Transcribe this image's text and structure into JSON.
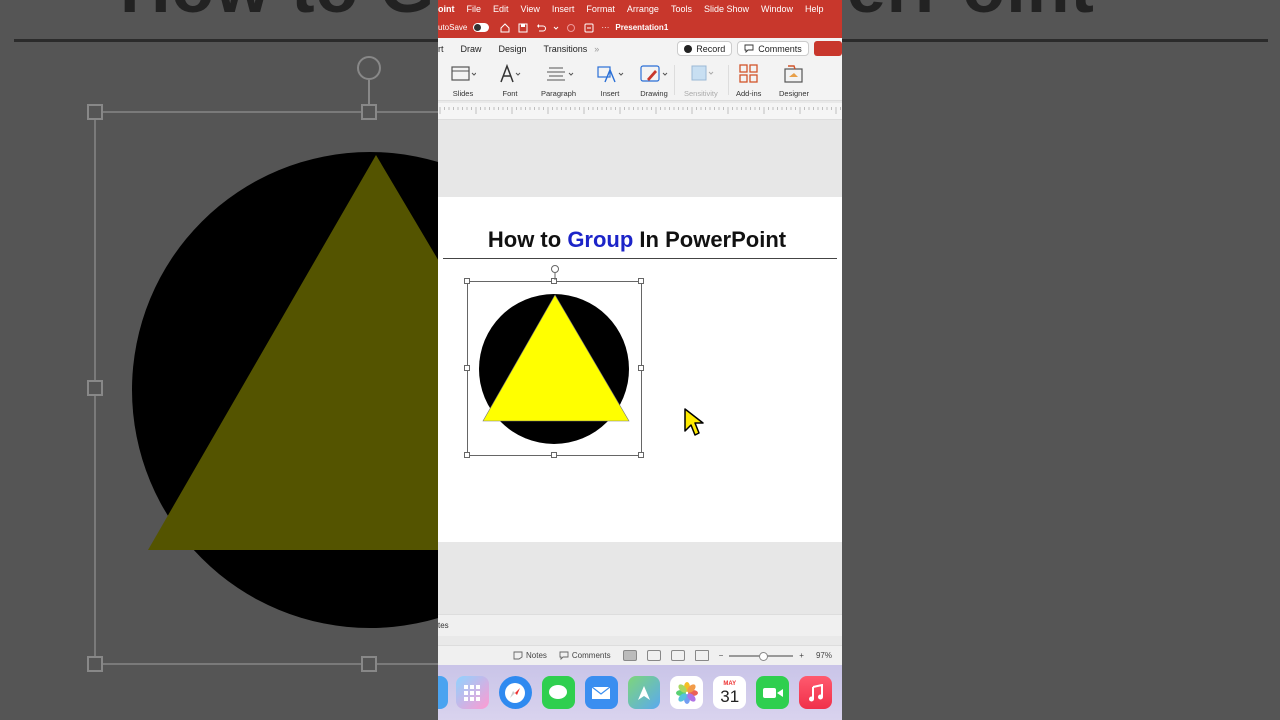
{
  "background": {
    "title_text": "How to Group In PowerPoint"
  },
  "menubar": {
    "app": "oint",
    "items": [
      "File",
      "Edit",
      "View",
      "Insert",
      "Format",
      "Arrange",
      "Tools",
      "Slide Show",
      "Window",
      "Help"
    ]
  },
  "titlebar": {
    "autosave_label": "utoSave",
    "document_title": "Presentation1",
    "more_glyph": "···"
  },
  "tabs": {
    "partial_first": "rt",
    "items": [
      "Draw",
      "Design",
      "Transitions"
    ],
    "more": "»",
    "record_label": "Record",
    "comments_label": "Comments"
  },
  "ribbon": {
    "groups": [
      {
        "label": "Slides",
        "icon": "slides-icon"
      },
      {
        "label": "Font",
        "icon": "font-icon"
      },
      {
        "label": "Paragraph",
        "icon": "paragraph-icon"
      },
      {
        "label": "Insert",
        "icon": "insert-icon"
      },
      {
        "label": "Drawing",
        "icon": "drawing-icon"
      },
      {
        "label": "Sensitivity",
        "icon": "sensitivity-icon",
        "disabled": true
      },
      {
        "label": "Add-ins",
        "icon": "add-ins-icon"
      },
      {
        "label": "Designer",
        "icon": "designer-icon"
      }
    ]
  },
  "slide": {
    "title_before": "How to ",
    "title_highlight": "Group",
    "title_after": " In PowerPoint",
    "highlight_color": "#1c24c8",
    "circle_color": "#000000",
    "triangle_color": "#ffff00"
  },
  "notes_pane": {
    "partial_label": "tes"
  },
  "statusbar": {
    "notes_label": "Notes",
    "comments_label": "Comments",
    "zoom_minus": "−",
    "zoom_plus": "+",
    "zoom_value": "97%"
  },
  "dock": {
    "calendar_month": "MAY",
    "calendar_day": "31",
    "apps": [
      "finder",
      "launchpad",
      "safari",
      "messages",
      "mail",
      "maps",
      "photos",
      "calendar",
      "facetime",
      "music"
    ]
  }
}
